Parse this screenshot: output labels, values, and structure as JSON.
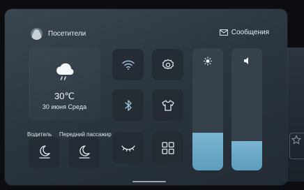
{
  "header": {
    "visitors_label": "Посетители",
    "messages_label": "Сообщения"
  },
  "weather": {
    "temperature": "30℃",
    "date": "30 июня Среда",
    "icon": "cloud-rain-icon"
  },
  "quick_toggles": [
    {
      "name": "wifi",
      "icon": "wifi-icon"
    },
    {
      "name": "settings",
      "icon": "gear-icon"
    },
    {
      "name": "bluetooth",
      "icon": "bluetooth-icon"
    },
    {
      "name": "theme",
      "icon": "shirt-icon"
    },
    {
      "name": "eye-care",
      "icon": "closed-eye-icon"
    },
    {
      "name": "apps",
      "icon": "grid-icon"
    }
  ],
  "seats": {
    "driver_label": "Водитель",
    "passenger_label": "Передний пассажир"
  },
  "sliders": {
    "brightness": {
      "icon": "sun-icon",
      "level": 0.31
    },
    "volume": {
      "icon": "speaker-icon",
      "level": 0.24
    }
  },
  "colors": {
    "accent": "#6ba8c6",
    "panel": "#2e3842",
    "icon": "#9fc3d8"
  }
}
